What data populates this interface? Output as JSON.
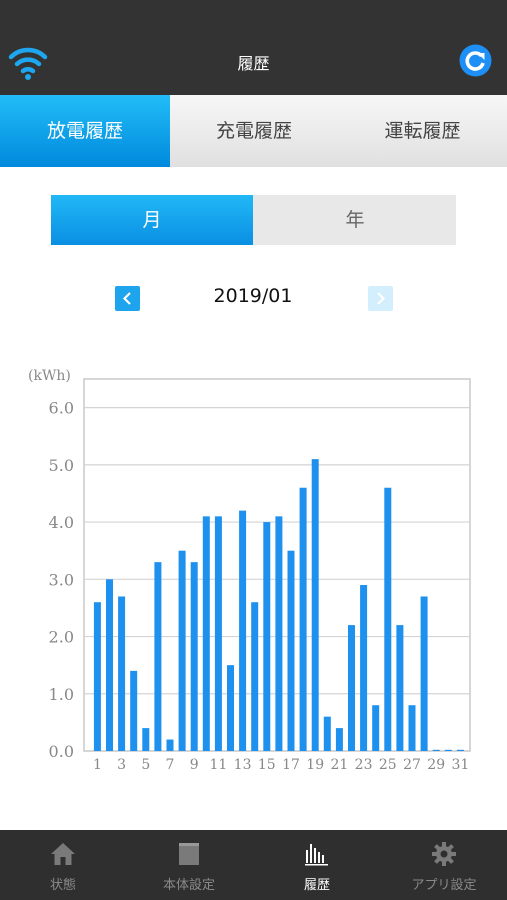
{
  "header": {
    "title": "履歴",
    "wifi_icon": "wifi-icon",
    "refresh_icon": "refresh-icon",
    "accent": "#1e90ff"
  },
  "tabs": [
    {
      "label": "放電履歴",
      "active": true
    },
    {
      "label": "充電履歴",
      "active": false
    },
    {
      "label": "運転履歴",
      "active": false
    }
  ],
  "segment": [
    {
      "label": "月",
      "active": true
    },
    {
      "label": "年",
      "active": false
    }
  ],
  "period": {
    "label": "2019/01",
    "prev_icon": "chevron-left-icon",
    "next_icon": "chevron-right-icon",
    "next_enabled": false
  },
  "chart_data": {
    "type": "bar",
    "ylabel": "(kWh)",
    "ylim": [
      0,
      6.5
    ],
    "yticks": [
      "0.0",
      "1.0",
      "2.0",
      "3.0",
      "4.0",
      "5.0",
      "6.0"
    ],
    "categories": [
      "1",
      "2",
      "3",
      "4",
      "5",
      "6",
      "7",
      "8",
      "9",
      "10",
      "11",
      "12",
      "13",
      "14",
      "15",
      "16",
      "17",
      "18",
      "19",
      "20",
      "21",
      "22",
      "23",
      "24",
      "25",
      "26",
      "27",
      "28",
      "29",
      "30",
      "31"
    ],
    "xtick_labels": [
      "1",
      "3",
      "5",
      "7",
      "9",
      "11",
      "13",
      "15",
      "17",
      "19",
      "21",
      "23",
      "25",
      "27",
      "29",
      "31"
    ],
    "values": [
      2.6,
      3.0,
      2.7,
      1.4,
      0.4,
      3.3,
      0.2,
      3.5,
      3.3,
      4.1,
      4.1,
      1.5,
      4.2,
      2.6,
      4.0,
      4.1,
      3.5,
      4.6,
      5.1,
      0.6,
      0.4,
      2.2,
      2.9,
      0.8,
      4.6,
      2.2,
      0.8,
      2.7,
      0.0,
      0.0,
      0.0
    ],
    "bar_color": "#1e90ee",
    "grid": true
  },
  "bottom_nav": [
    {
      "label": "状態",
      "icon": "home-icon",
      "active": false
    },
    {
      "label": "本体設定",
      "icon": "device-icon",
      "active": false
    },
    {
      "label": "履歴",
      "icon": "bar-chart-icon",
      "active": true
    },
    {
      "label": "アプリ設定",
      "icon": "gear-icon",
      "active": false
    }
  ]
}
